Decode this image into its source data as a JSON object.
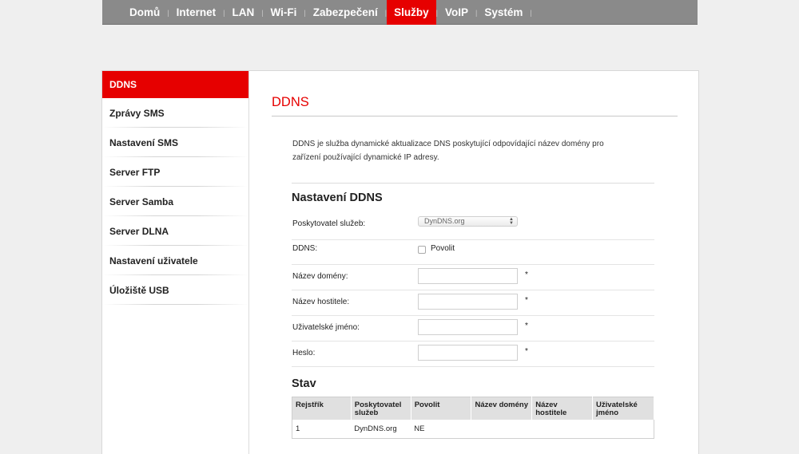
{
  "nav": {
    "items": [
      {
        "label": "Domů",
        "active": false
      },
      {
        "label": "Internet",
        "active": false
      },
      {
        "label": "LAN",
        "active": false
      },
      {
        "label": "Wi-Fi",
        "active": false
      },
      {
        "label": "Zabezpečení",
        "active": false
      },
      {
        "label": "Služby",
        "active": true
      },
      {
        "label": "VoIP",
        "active": false
      },
      {
        "label": "Systém",
        "active": false
      }
    ]
  },
  "sidebar": {
    "items": [
      {
        "label": "DDNS",
        "active": true
      },
      {
        "label": "Zprávy SMS",
        "active": false
      },
      {
        "label": "Nastavení SMS",
        "active": false
      },
      {
        "label": "Server FTP",
        "active": false
      },
      {
        "label": "Server Samba",
        "active": false
      },
      {
        "label": "Server DLNA",
        "active": false
      },
      {
        "label": "Nastavení uživatele",
        "active": false
      },
      {
        "label": "Úložiště USB",
        "active": false
      }
    ]
  },
  "main": {
    "title": "DDNS",
    "description": "DDNS je služba dynamické aktualizace DNS poskytující odpovídající název domény pro zařízení používající dynamické IP adresy.",
    "settings": {
      "title": "Nastavení DDNS",
      "provider_label": "Poskytovatel služeb:",
      "provider_value": "DynDNS.org",
      "ddns_label": "DDNS:",
      "enable_label": "Povolit",
      "enable_checked": false,
      "domain_label": "Název domény:",
      "domain_value": "",
      "hostname_label": "Název hostitele:",
      "hostname_value": "",
      "username_label": "Uživatelské jméno:",
      "username_value": "",
      "password_label": "Heslo:",
      "password_value": "",
      "required_mark": "*"
    },
    "status": {
      "title": "Stav",
      "columns": [
        "Rejstřík",
        "Poskytovatel služeb",
        "Povolit",
        "Název domény",
        "Název hostitele",
        "Uživatelské jméno"
      ],
      "rows": [
        [
          "1",
          "DynDNS.org",
          "NE",
          "",
          "",
          ""
        ]
      ]
    }
  },
  "colors": {
    "accent": "#e60000",
    "nav_bg": "#8a8a8a",
    "page_bg": "#efefef"
  }
}
